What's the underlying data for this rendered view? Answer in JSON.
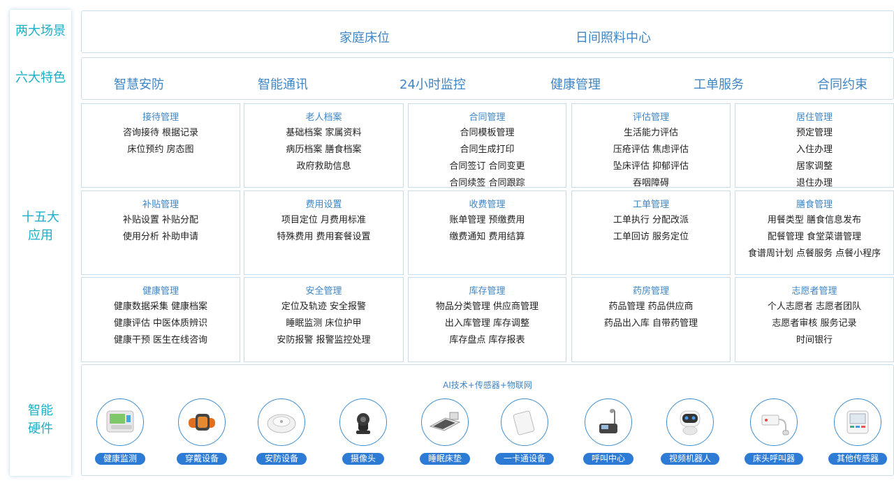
{
  "sidebar": {
    "scenes_label": "两大场景",
    "features_label": "六大特色",
    "apps_label_line1": "十五大",
    "apps_label_line2": "应用",
    "hardware_label_line1": "智能",
    "hardware_label_line2": "硬件"
  },
  "scenes": [
    "家庭床位",
    "日间照料中心"
  ],
  "features": [
    "智慧安防",
    "智能通讯",
    "24小时监控",
    "健康管理",
    "工单服务",
    "合同约束"
  ],
  "apps": [
    {
      "title": "接待管理",
      "lines": [
        "咨询接待 根据记录",
        "床位预约 房态图"
      ]
    },
    {
      "title": "老人档案",
      "lines": [
        "基础档案 家属资料",
        "病历档案 膳食档案",
        "政府救助信息"
      ]
    },
    {
      "title": "合同管理",
      "lines": [
        "合同模板管理",
        "合同生成打印",
        "合同签订 合同变更",
        "合同续签 合同跟踪"
      ]
    },
    {
      "title": "评估管理",
      "lines": [
        "生活能力评估",
        "压疮评估 焦虑评估",
        "坠床评估 抑郁评估",
        "吞咽障碍"
      ]
    },
    {
      "title": "居住管理",
      "lines": [
        "预定管理",
        "入住办理",
        "居家调整",
        "退住办理"
      ]
    },
    {
      "title": "补贴管理",
      "lines": [
        "补贴设置 补贴分配",
        "使用分析 补助申请"
      ]
    },
    {
      "title": "费用设置",
      "lines": [
        "项目定位 月费用标准",
        "特殊费用 费用套餐设置"
      ]
    },
    {
      "title": "收费管理",
      "lines": [
        "账单管理 预缴费用",
        "缴费通知 费用结算"
      ]
    },
    {
      "title": "工单管理",
      "lines": [
        "工单执行 分配改派",
        "工单回访 服务定位"
      ]
    },
    {
      "title": "膳食管理",
      "lines": [
        "用餐类型 膳食信息发布",
        "配餐管理 食堂菜谱管理",
        "食谱周计划 点餐服务 点餐小程序"
      ]
    },
    {
      "title": "健康管理",
      "lines": [
        "健康数据采集 健康档案",
        "健康评估 中医体质辨识",
        "健康干预 医生在线咨询"
      ]
    },
    {
      "title": "安全管理",
      "lines": [
        "定位及轨迹 安全报警",
        "睡眠监测 床位护甲",
        "安防报警 报警监控处理"
      ]
    },
    {
      "title": "库存管理",
      "lines": [
        "物品分类管理 供应商管理",
        "出入库管理 库存调整",
        "库存盘点 库存报表"
      ]
    },
    {
      "title": "药房管理",
      "lines": [
        "药品管理 药品供应商",
        "药品出入库 自带药管理"
      ]
    },
    {
      "title": "志愿者管理",
      "lines": [
        "个人志愿者 志愿者团队",
        "志愿者审核 服务记录",
        "时间银行"
      ]
    }
  ],
  "hardware": {
    "caption": "AI技术+传感器+物联网",
    "items": [
      {
        "label": "健康监测",
        "icon": "health-monitor-icon"
      },
      {
        "label": "穿戴设备",
        "icon": "smartwatch-icon"
      },
      {
        "label": "安防设备",
        "icon": "smoke-detector-icon"
      },
      {
        "label": "摄像头",
        "icon": "camera-icon"
      },
      {
        "label": "睡眠床垫",
        "icon": "sleep-mattress-icon"
      },
      {
        "label": "一卡通设备",
        "icon": "card-reader-icon"
      },
      {
        "label": "呼叫中心",
        "icon": "call-center-phone-icon"
      },
      {
        "label": "视频机器人",
        "icon": "video-robot-icon"
      },
      {
        "label": "床头呼叫器",
        "icon": "bedside-caller-icon"
      },
      {
        "label": "其他传感器",
        "icon": "sensor-icon"
      }
    ]
  },
  "colors": {
    "accent": "#1ab0c8",
    "title_blue": "#3f86c6",
    "badge_blue": "#2e7bd6",
    "border": "#c8dcea"
  }
}
